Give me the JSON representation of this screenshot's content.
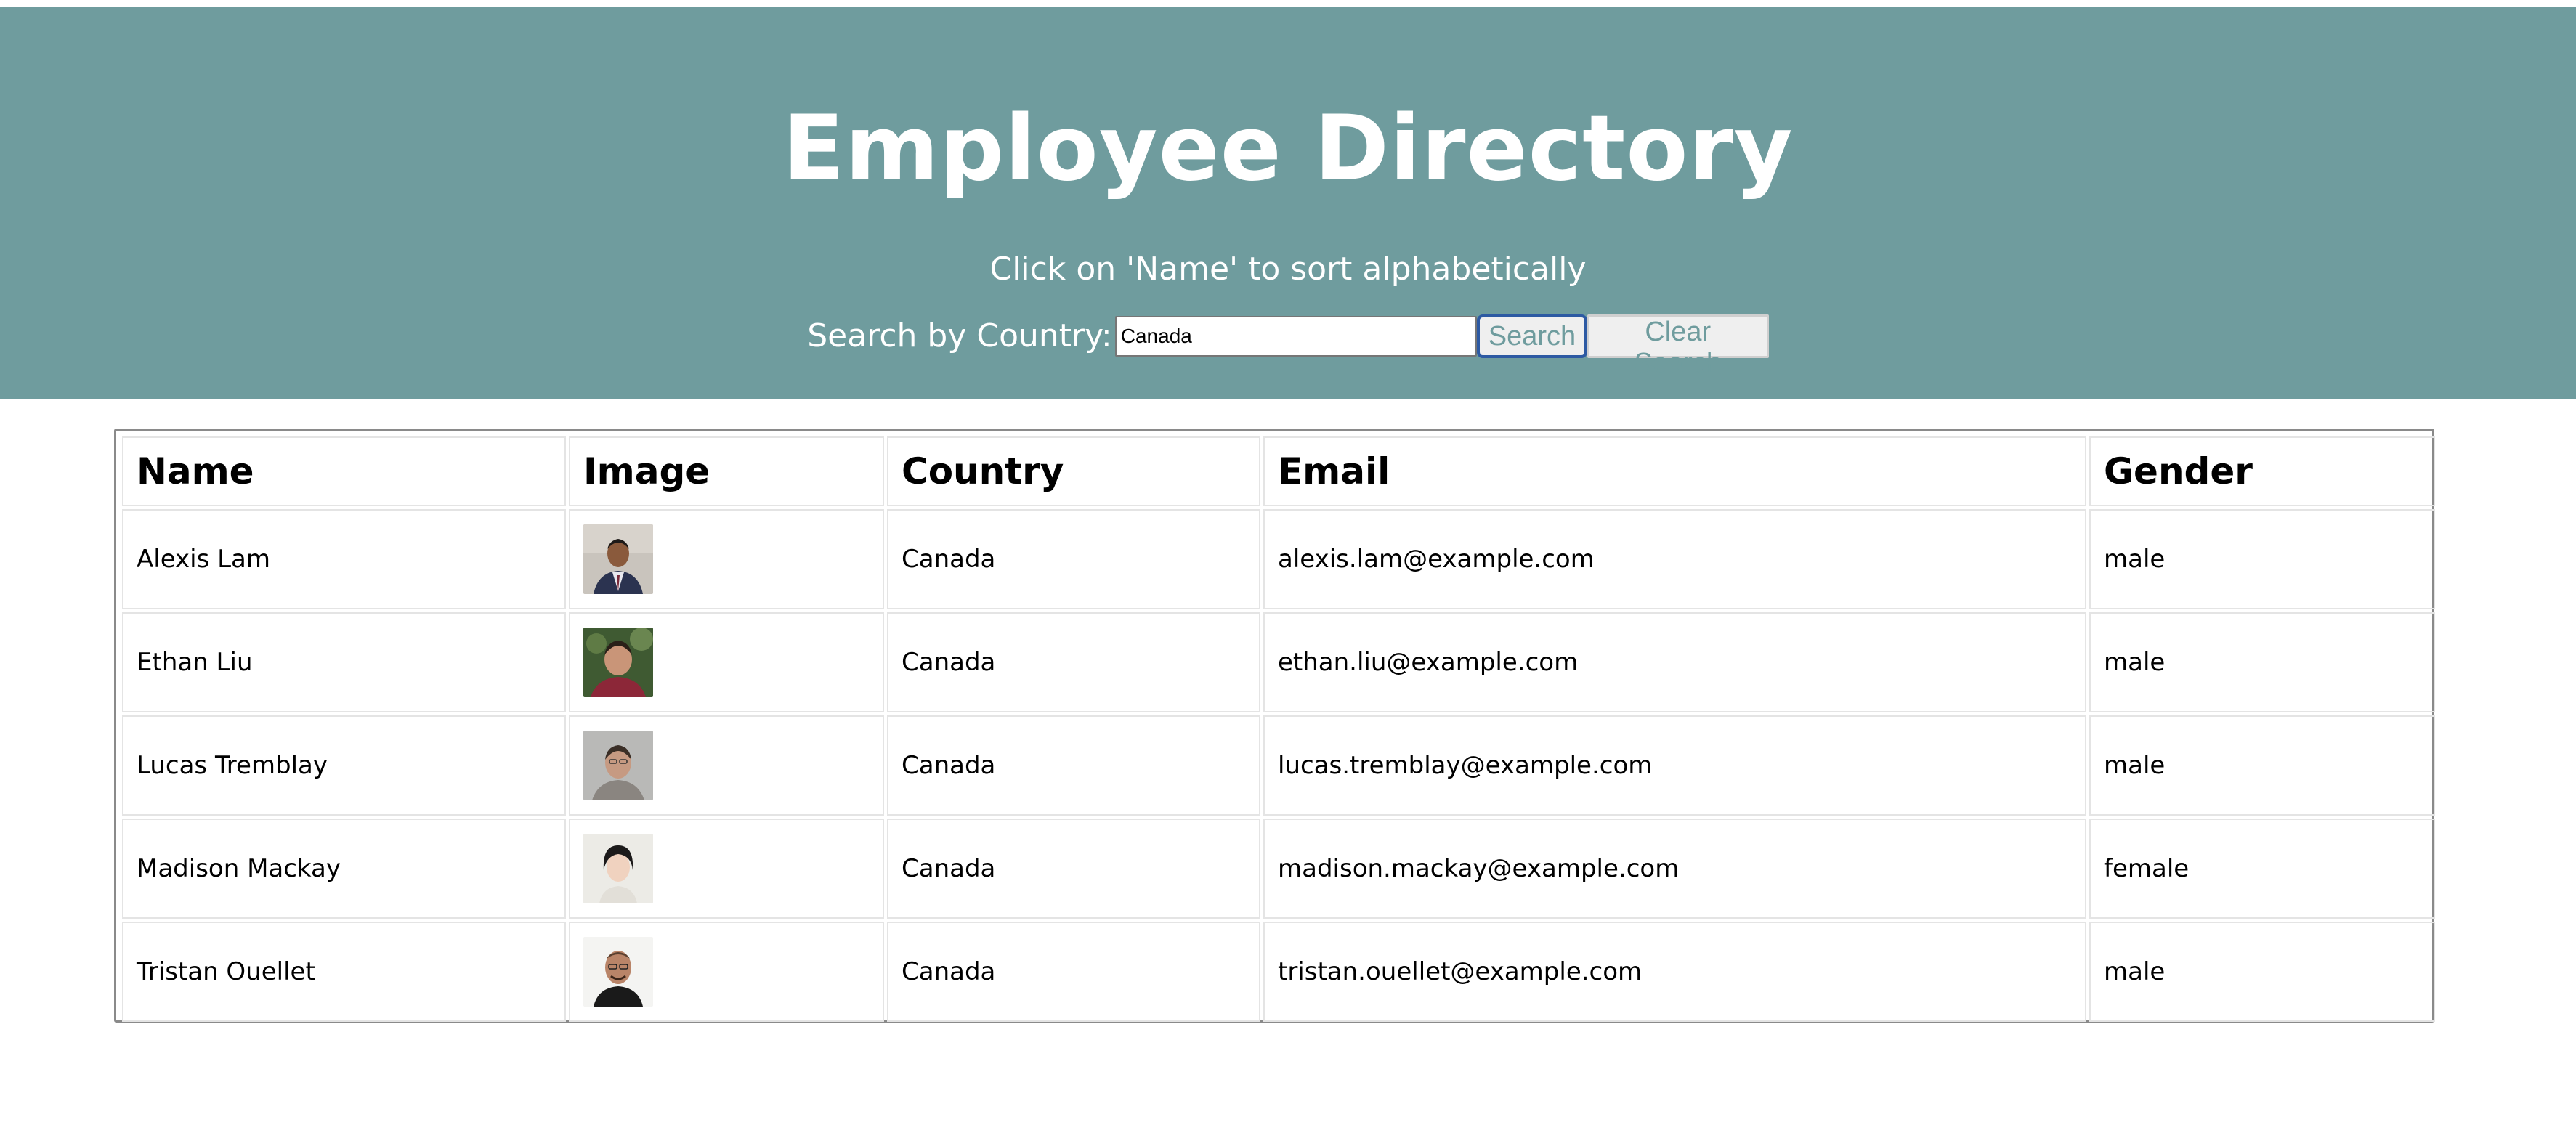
{
  "header": {
    "title": "Employee Directory",
    "subtitle": "Click on 'Name' to sort alphabetically",
    "search_label": "Search by Country:",
    "search_value": "Canada",
    "search_button": "Search",
    "clear_button": "Clear Search",
    "background_color": "#6f9c9e"
  },
  "table": {
    "columns": [
      "Name",
      "Image",
      "Country",
      "Email",
      "Gender"
    ],
    "rows": [
      {
        "name": "Alexis Lam",
        "image": "avatar-alexis-lam",
        "country": "Canada",
        "email": "alexis.lam@example.com",
        "gender": "male"
      },
      {
        "name": "Ethan Liu",
        "image": "avatar-ethan-liu",
        "country": "Canada",
        "email": "ethan.liu@example.com",
        "gender": "male"
      },
      {
        "name": "Lucas Tremblay",
        "image": "avatar-lucas-tremblay",
        "country": "Canada",
        "email": "lucas.tremblay@example.com",
        "gender": "male"
      },
      {
        "name": "Madison Mackay",
        "image": "avatar-madison-mackay",
        "country": "Canada",
        "email": "madison.mackay@example.com",
        "gender": "female"
      },
      {
        "name": "Tristan Ouellet",
        "image": "avatar-tristan-ouellet",
        "country": "Canada",
        "email": "tristan.ouellet@example.com",
        "gender": "male"
      }
    ]
  }
}
